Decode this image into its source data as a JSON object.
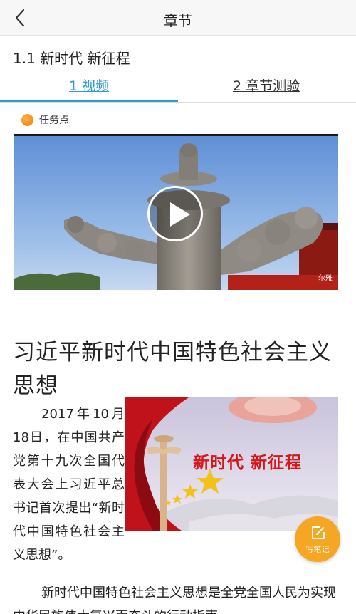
{
  "header": {
    "title": "章节",
    "back_icon": "chevron-left-icon"
  },
  "chapter": {
    "title": "1.1 新时代 新征程"
  },
  "tabs": [
    {
      "label": "1 视频",
      "active": true
    },
    {
      "label": "2 章节测验",
      "active": false
    }
  ],
  "task_point": {
    "label": "任务点",
    "dot_color": "#f39a1a"
  },
  "video": {
    "play_icon": "play-icon",
    "watermark": "尔雅"
  },
  "article": {
    "heading": "习近平新时代中国特色社会主义思想",
    "paragraph_1": "2017年10月18日，在中国共产党第十九次全国代表大会上习近平总书记首次提出“新时代中国特色社会主义思想”。",
    "banner_text": "新时代 新征程",
    "paragraph_2": "新时代中国特色社会主义思想是全党全国人民为实现中华民族伟大复兴而奋斗的行动指南"
  },
  "fab": {
    "label": "写笔记",
    "icon": "edit-note-icon",
    "color": "#f5a623"
  },
  "colors": {
    "accent": "#2b9bd1",
    "banner_red": "#d4171b"
  }
}
